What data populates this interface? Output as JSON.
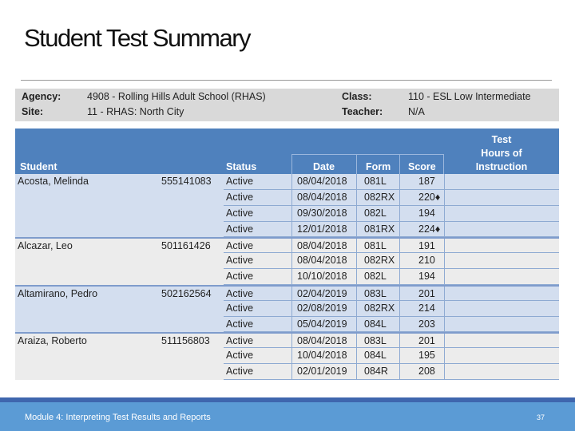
{
  "title": "Student Test Summary",
  "info": {
    "agency_label": "Agency:",
    "agency": "4908 - Rolling Hills Adult School (RHAS)",
    "site_label": "Site:",
    "site": "11 - RHAS: North City",
    "class_label": "Class:",
    "class": "110 - ESL Low Intermediate",
    "teacher_label": "Teacher:",
    "teacher": "N/A"
  },
  "headers": {
    "student": "Student",
    "status": "Status",
    "date": "Date",
    "form": "Form",
    "score": "Score",
    "hours_1": "Test",
    "hours_2": "Hours of",
    "hours_3": "Instruction"
  },
  "rows": [
    {
      "student": "Acosta, Melinda",
      "id": "555141083",
      "status": "Active",
      "date": "08/04/2018",
      "form": "081L",
      "score": "187"
    },
    {
      "student": "",
      "id": "",
      "status": "Active",
      "date": "08/04/2018",
      "form": "082RX",
      "score": "220♦"
    },
    {
      "student": "",
      "id": "",
      "status": "Active",
      "date": "09/30/2018",
      "form": "082L",
      "score": "194"
    },
    {
      "student": "",
      "id": "",
      "status": "Active",
      "date": "12/01/2018",
      "form": "081RX",
      "score": "224♦"
    },
    {
      "student": "Alcazar, Leo",
      "id": "501161426",
      "status": "Active",
      "date": "08/04/2018",
      "form": "081L",
      "score": "191"
    },
    {
      "student": "",
      "id": "",
      "status": "Active",
      "date": "08/04/2018",
      "form": "082RX",
      "score": "210"
    },
    {
      "student": "",
      "id": "",
      "status": "Active",
      "date": "10/10/2018",
      "form": "082L",
      "score": "194"
    },
    {
      "student": "Altamirano, Pedro",
      "id": "502162564",
      "status": "Active",
      "date": "02/04/2019",
      "form": "083L",
      "score": "201"
    },
    {
      "student": "",
      "id": "",
      "status": "Active",
      "date": "02/08/2019",
      "form": "082RX",
      "score": "214"
    },
    {
      "student": "",
      "id": "",
      "status": "Active",
      "date": "05/04/2019",
      "form": "084L",
      "score": "203"
    },
    {
      "student": "Araiza, Roberto",
      "id": "511156803",
      "status": "Active",
      "date": "08/04/2018",
      "form": "083L",
      "score": "201"
    },
    {
      "student": "",
      "id": "",
      "status": "Active",
      "date": "10/04/2018",
      "form": "084L",
      "score": "195"
    },
    {
      "student": "",
      "id": "",
      "status": "Active",
      "date": "02/01/2019",
      "form": "084R",
      "score": "208"
    }
  ],
  "groups": [
    0,
    0,
    0,
    0,
    1,
    1,
    1,
    0,
    0,
    0,
    1,
    1,
    1
  ],
  "footer": {
    "text": "Module 4: Interpreting Test Results and Reports",
    "page": "37"
  }
}
